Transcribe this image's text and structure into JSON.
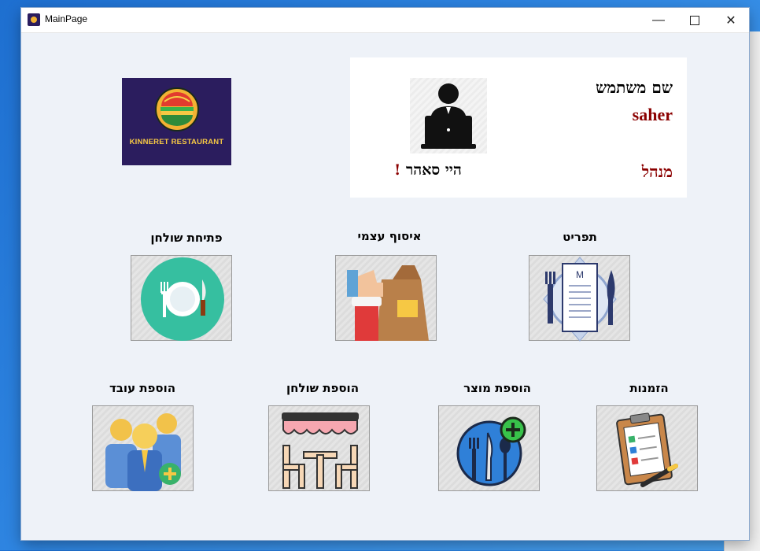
{
  "window": {
    "title": "MainPage",
    "controls": {
      "minimize": "—",
      "close": "✕"
    }
  },
  "logo": {
    "text": "KINNERET RESTAURANT",
    "background": "#2b1d5e",
    "text_color": "#f6c844"
  },
  "user_card": {
    "username_label": "שם משתמש",
    "username": "saher",
    "role": "מנהל",
    "greeting": "היי  סאהר",
    "greeting_mark": "!",
    "accent_color": "#8b0000"
  },
  "tiles": {
    "open_table": {
      "label": "פתיחת שולחן",
      "icon": "plate-fork-knife-icon"
    },
    "self_pickup": {
      "label": "איסוף עצמי",
      "icon": "takeaway-bag-icon"
    },
    "menu": {
      "label": "תפריט",
      "icon": "menu-card-icon"
    },
    "add_employee": {
      "label": "הוספת עובד",
      "icon": "add-employee-icon"
    },
    "add_table": {
      "label": "הוספת שולחן",
      "icon": "table-chairs-icon"
    },
    "add_product": {
      "label": "הוספת מוצר",
      "icon": "add-product-icon"
    },
    "orders": {
      "label": "הזמנות",
      "icon": "clipboard-icon"
    }
  }
}
